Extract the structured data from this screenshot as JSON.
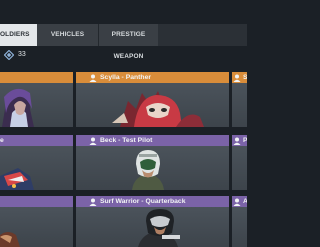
{
  "tabs": [
    {
      "label": "OLDIERS",
      "active": true
    },
    {
      "label": "VEHICLES",
      "active": false
    },
    {
      "label": "PRESTIGE WEAPON",
      "active": false
    }
  ],
  "filter": {
    "count": "33"
  },
  "colors": {
    "background": "#1b2026",
    "card": "#434a52",
    "header_orange": "#d98d3a",
    "header_purple": "#7b63a8",
    "tab_active": "#e4e7ea"
  },
  "cards": [
    {
      "title": "",
      "header": "orange",
      "row": 0,
      "col": 0
    },
    {
      "title": "Scylla - Panther",
      "header": "orange",
      "row": 0,
      "col": 1,
      "icon": "character-icon"
    },
    {
      "title": "S",
      "header": "orange",
      "row": 0,
      "col": 2,
      "icon": "character-icon"
    },
    {
      "title": "e",
      "header": "purple",
      "row": 1,
      "col": 0
    },
    {
      "title": "Beck - Test Pilot",
      "header": "purple",
      "row": 1,
      "col": 1,
      "icon": "character-icon"
    },
    {
      "title": "P",
      "header": "purple",
      "row": 1,
      "col": 2,
      "icon": "character-icon"
    },
    {
      "title": "",
      "header": "purple",
      "row": 2,
      "col": 0
    },
    {
      "title": "Surf Warrior - Quarterback",
      "header": "purple",
      "row": 2,
      "col": 1,
      "icon": "character-icon"
    },
    {
      "title": "A",
      "header": "purple",
      "row": 2,
      "col": 2,
      "icon": "character-icon"
    }
  ]
}
